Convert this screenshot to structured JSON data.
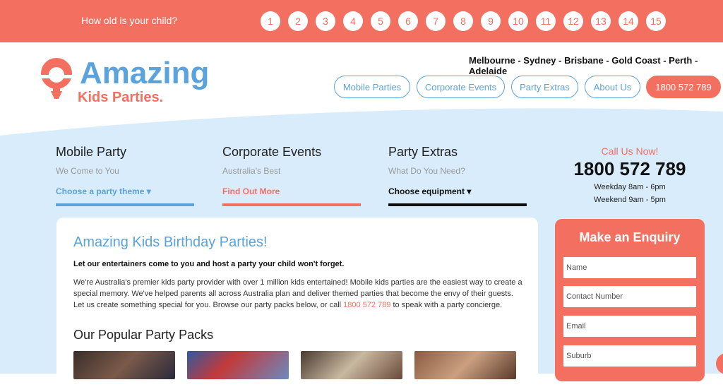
{
  "topbar": {
    "question": "How old is your child?",
    "ages": [
      "1",
      "2",
      "3",
      "4",
      "5",
      "6",
      "7",
      "8",
      "9",
      "10",
      "11",
      "12",
      "13",
      "14",
      "15"
    ]
  },
  "brand": {
    "name": "Amazing",
    "tagline": "Kids Parties."
  },
  "header": {
    "cities": "Melbourne - Sydney - Brisbane - Gold Coast - Perth - Adelaide",
    "nav": [
      "Mobile Parties",
      "Corporate Events",
      "Party Extras",
      "About Us"
    ],
    "phone": "1800 572 789"
  },
  "services": [
    {
      "title": "Mobile Party",
      "subtitle": "We Come to You",
      "link": "Choose a party theme ▾",
      "color": "#5aa3dc"
    },
    {
      "title": "Corporate Events",
      "subtitle": "Australia's Best",
      "link": "Find Out More",
      "color": "#f37060"
    },
    {
      "title": "Party Extras",
      "subtitle": "What Do You Need?",
      "link": "Choose equipment ▾",
      "color": "#111111"
    }
  ],
  "call": {
    "label": "Call Us Now!",
    "number": "1800 572 789",
    "weekday": "Weekday 8am - 6pm",
    "weekend": "Weekend 9am - 5pm"
  },
  "main": {
    "heading": "Amazing Kids Birthday Parties!",
    "lead": "Let our entertainers come to you and host a party your child won't forget.",
    "body_before": "We're Australia's premier kids party provider with over 1 million kids entertained! Mobile kids parties are the easiest way to create a special memory. We've helped parents all across Australia plan and deliver themed parties that become the envy of their guests. Let us create something special for you. Browse our party packs below, or call ",
    "body_phone": "1800 572 789",
    "body_after": " to speak with a party concierge.",
    "packs_heading": "Our Popular Party Packs"
  },
  "enquiry": {
    "title": "Make an Enquiry",
    "fields": [
      "Name",
      "Contact Number",
      "Email",
      "Suburb"
    ]
  },
  "colors": {
    "accent": "#f37060",
    "brand_blue": "#5aa3dc",
    "bg_blue": "#d8ecfb"
  }
}
